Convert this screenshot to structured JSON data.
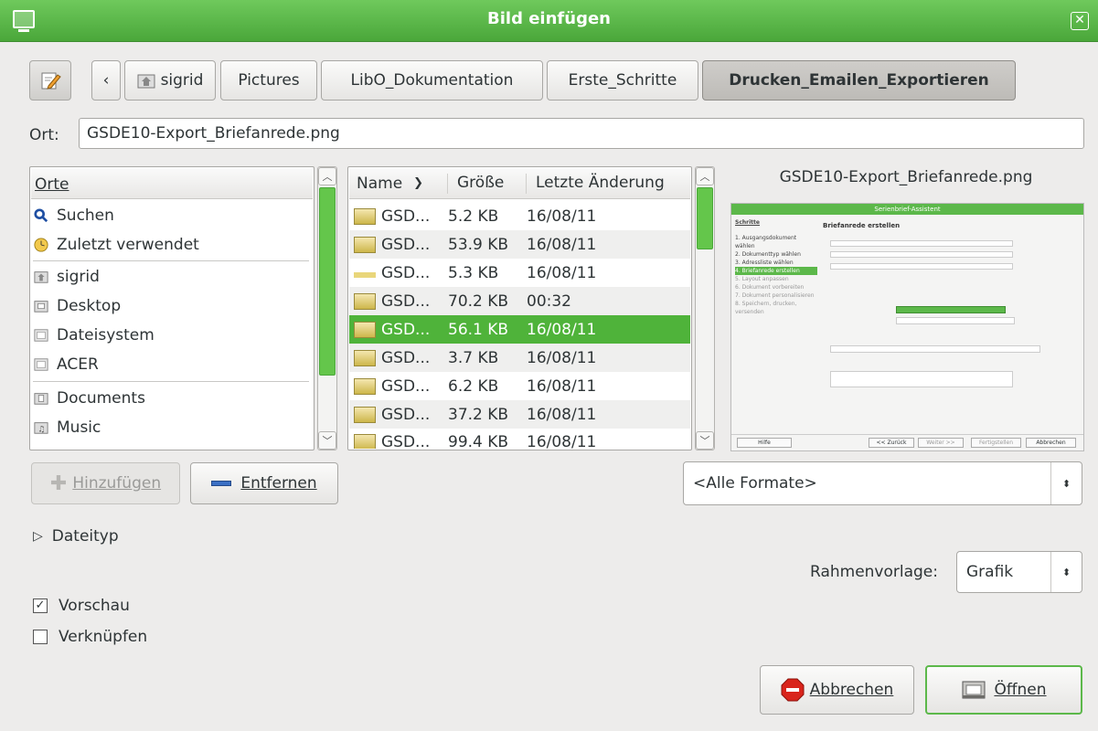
{
  "window": {
    "title": "Bild einfügen"
  },
  "pathbar": {
    "segments": [
      "sigrid",
      "Pictures",
      "LibO_Dokumentation",
      "Erste_Schritte",
      "Drucken_Emailen_Exportieren"
    ],
    "back_glyph": "‹"
  },
  "location": {
    "label": "Ort:",
    "value": "GSDE10-Export_Briefanrede.png"
  },
  "places": {
    "header": "Orte",
    "items": [
      {
        "label": "Suchen",
        "icon": "search-icon"
      },
      {
        "label": "Zuletzt verwendet",
        "icon": "recent-icon"
      },
      {
        "label": "sigrid",
        "icon": "home-folder-icon"
      },
      {
        "label": "Desktop",
        "icon": "desktop-icon"
      },
      {
        "label": "Dateisystem",
        "icon": "filesystem-icon"
      },
      {
        "label": "ACER",
        "icon": "drive-icon"
      },
      {
        "label": "Documents",
        "icon": "documents-folder-icon"
      },
      {
        "label": "Music",
        "icon": "music-folder-icon"
      }
    ]
  },
  "files": {
    "columns": {
      "name": "Name",
      "size": "Größe",
      "modified": "Letzte Änderung"
    },
    "rows": [
      {
        "name": "GSD...",
        "size": "5.2 KB",
        "modified": "16/08/11"
      },
      {
        "name": "GSD...",
        "size": "53.9 KB",
        "modified": "16/08/11"
      },
      {
        "name": "GSD...",
        "size": "5.3 KB",
        "modified": "16/08/11"
      },
      {
        "name": "GSD...",
        "size": "70.2 KB",
        "modified": "00:32"
      },
      {
        "name": "GSD...",
        "size": "56.1 KB",
        "modified": "16/08/11",
        "selected": true
      },
      {
        "name": "GSD...",
        "size": "3.7 KB",
        "modified": "16/08/11"
      },
      {
        "name": "GSD...",
        "size": "6.2 KB",
        "modified": "16/08/11"
      },
      {
        "name": "GSD...",
        "size": "37.2 KB",
        "modified": "16/08/11"
      },
      {
        "name": "GSD...",
        "size": "99.4 KB",
        "modified": "16/08/11"
      }
    ]
  },
  "preview": {
    "filename": "GSDE10-Export_Briefanrede.png",
    "dialog_title": "Serienbrief-Assistent",
    "steps_header": "Schritte",
    "steps": [
      "1. Ausgangsdokument wählen",
      "2. Dokumenttyp wählen",
      "3. Adressliste wählen",
      "4. Briefanrede erstellen",
      "5. Layout anpassen",
      "6. Dokument vorbereiten",
      "7. Dokument personalisieren",
      "8. Speichern, drucken, versenden"
    ],
    "section_title": "Briefanrede erstellen",
    "buttons": [
      "Hilfe",
      "<< Zurück",
      "Weiter >>",
      "Fertigstellen",
      "Abbrechen"
    ]
  },
  "buttons": {
    "add": "Hinzufügen",
    "remove": "Entfernen",
    "cancel": "Abbrechen",
    "open": "Öffnen"
  },
  "filter": {
    "value": "<Alle Formate>"
  },
  "filetype": {
    "label": "Dateityp"
  },
  "frame_style": {
    "label": "Rahmenvorlage:",
    "value": "Grafik"
  },
  "options": {
    "preview": {
      "label": "Vorschau",
      "checked": true
    },
    "link": {
      "label": "Verknüpfen",
      "checked": false
    }
  }
}
